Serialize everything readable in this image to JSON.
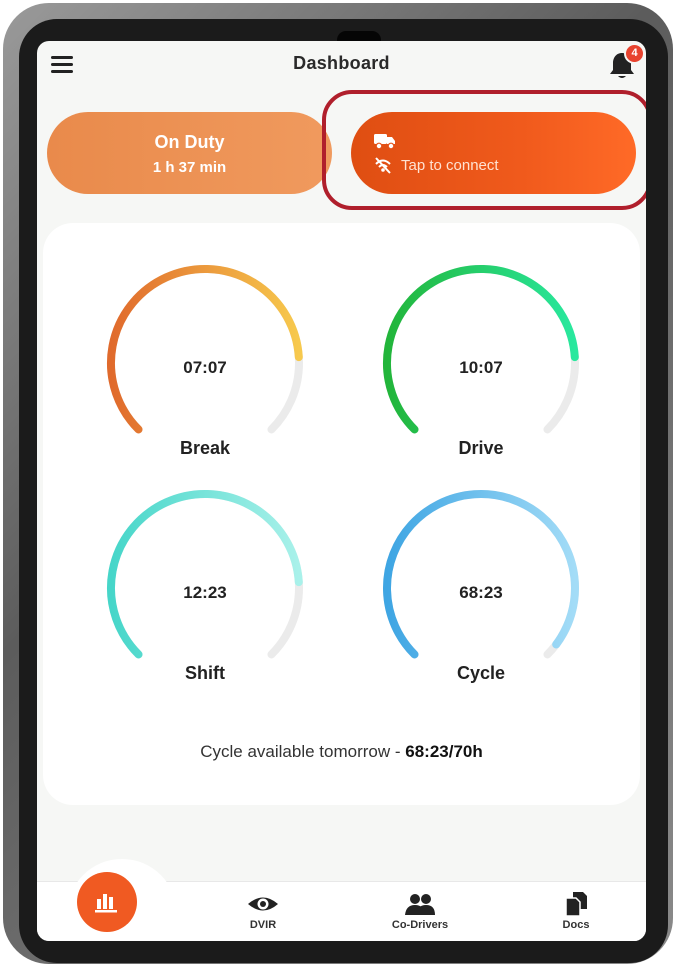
{
  "header": {
    "title": "Dashboard",
    "notification_count": "4"
  },
  "duty_status": {
    "label": "On Duty",
    "duration": "1 h 37 min"
  },
  "eld_connect": {
    "label": "Tap to connect"
  },
  "gauges": [
    {
      "name": "Break",
      "value": "07:07",
      "fill_fraction": 0.82,
      "color_start": "#e06a2c",
      "color_end": "#f7c94d"
    },
    {
      "name": "Drive",
      "value": "10:07",
      "fill_fraction": 0.82,
      "color_start": "#22b53a",
      "color_end": "#29e89e"
    },
    {
      "name": "Shift",
      "value": "12:23",
      "fill_fraction": 0.82,
      "color_start": "#46d6c9",
      "color_end": "#a9f1ea"
    },
    {
      "name": "Cycle",
      "value": "68:23",
      "fill_fraction": 0.97,
      "color_start": "#3ea5e3",
      "color_end": "#a3dcf7"
    }
  ],
  "cycle_note": {
    "text": "Cycle available tomorrow -",
    "value": "68:23/70h"
  },
  "tabs": [
    {
      "label": "DVIR",
      "icon": "eye-icon"
    },
    {
      "label": "Co-Drivers",
      "icon": "people-icon"
    },
    {
      "label": "Docs",
      "icon": "docs-icon"
    }
  ],
  "colors": {
    "accent": "#f05a22",
    "duty": "#ec9152",
    "highlight_border": "#b01f2c"
  }
}
